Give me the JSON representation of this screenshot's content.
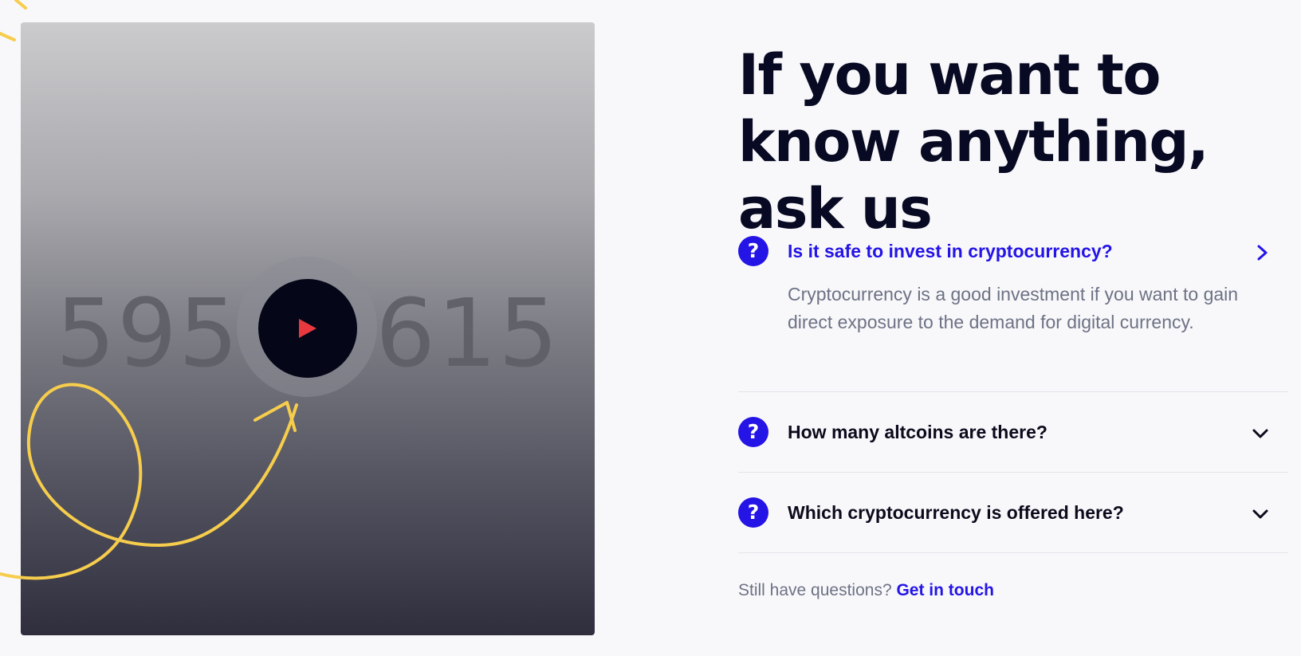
{
  "video": {
    "number_left": "595",
    "number_right": "615"
  },
  "faq": {
    "title": "If you want to know anything, ask us",
    "items": [
      {
        "icon": "question-icon",
        "question": "Is it safe to invest in cryptocurrency?",
        "answer": "Cryptocurrency is a good investment if you want to gain direct exposure to the demand for digital currency.",
        "expanded": true
      },
      {
        "icon": "question-icon",
        "question": "How many altcoins are there?",
        "expanded": false
      },
      {
        "icon": "question-icon",
        "question": "Which cryptocurrency is offered here?",
        "expanded": false
      }
    ],
    "question_mark": "?",
    "footer_text": "Still have questions?",
    "footer_link": "Get in touch"
  },
  "colors": {
    "accent": "#2414e6",
    "heading": "#070a22",
    "body_text": "#6d7284",
    "play_button": "#050719",
    "play_triangle": "#e8393f",
    "scribble": "#f6cd4c"
  }
}
